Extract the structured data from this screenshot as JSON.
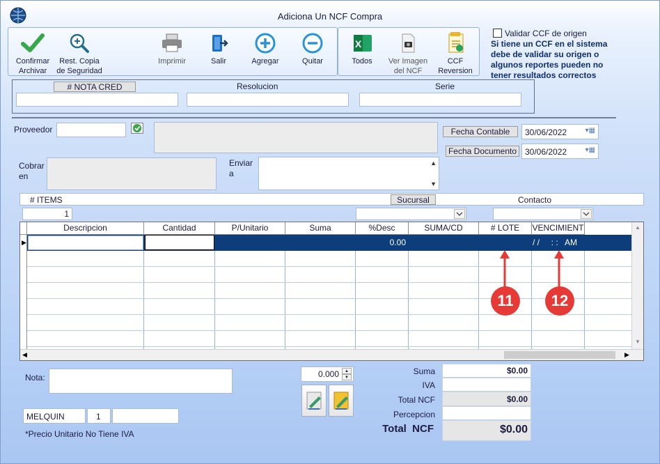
{
  "window": {
    "title": "Adiciona Un NCF Compra"
  },
  "toolbar": {
    "confirmar": "Confirmar\nArchivar",
    "rest_copia": "Rest. Copia\nde Seguridad",
    "imprimir": "Imprimir",
    "salir": "Salir",
    "agregar": "Agregar",
    "quitar": "Quitar",
    "todos": "Todos",
    "ver_imagen": "Ver Imagen\ndel NCF",
    "ccf_reversion": "CCF\nReversion"
  },
  "validation": {
    "checkbox_label": "Validar CCF de origen",
    "note": "Si tiene un CCF en el sistema debe de validar su origen o algunos reportes pueden no tener resultados correctos"
  },
  "ncf": {
    "nota_cred": "# NOTA CRED",
    "resolucion": "Resolucion",
    "serie": "Serie"
  },
  "form": {
    "proveedor": "Proveedor",
    "cobrar_en": "Cobrar\nen",
    "enviar_a": "Enviar\na",
    "fecha_contable_label": "Fecha Contable",
    "fecha_contable": "30/06/2022",
    "fecha_documento_label": "Fecha Documento",
    "fecha_documento": "30/06/2022",
    "items_label": "# ITEMS",
    "items_value": "1",
    "sucursal_label": "Sucursal",
    "contacto_label": "Contacto"
  },
  "grid": {
    "columns": [
      "Descripcion",
      "Cantidad",
      "P/Unitario",
      "Suma",
      "%Desc",
      "SUMA/CD",
      "# LOTE",
      "VENCIMIENT"
    ],
    "row1": {
      "desc_pct": "0.00",
      "vencimiento": "/ /     : :   AM"
    }
  },
  "footer": {
    "nota_label": "Nota:",
    "spinner_value": "0.000",
    "user": "MELQUIN",
    "user_num": "1",
    "footnote": "*Precio Unitario No Tiene IVA"
  },
  "totals": {
    "suma_label": "Suma",
    "suma": "$0.00",
    "iva_label": "IVA",
    "iva": "",
    "total_ncf_label": "Total  NCF",
    "total_ncf": "$0.00",
    "percepcion_label": "Percepcion",
    "percepcion": "",
    "grand_label": "Total  NCF",
    "grand": "$0.00"
  },
  "annotations": {
    "marker_11": "11",
    "marker_12": "12"
  },
  "colors": {
    "accent": "#0d3d7a",
    "marker": "#e53a36"
  }
}
